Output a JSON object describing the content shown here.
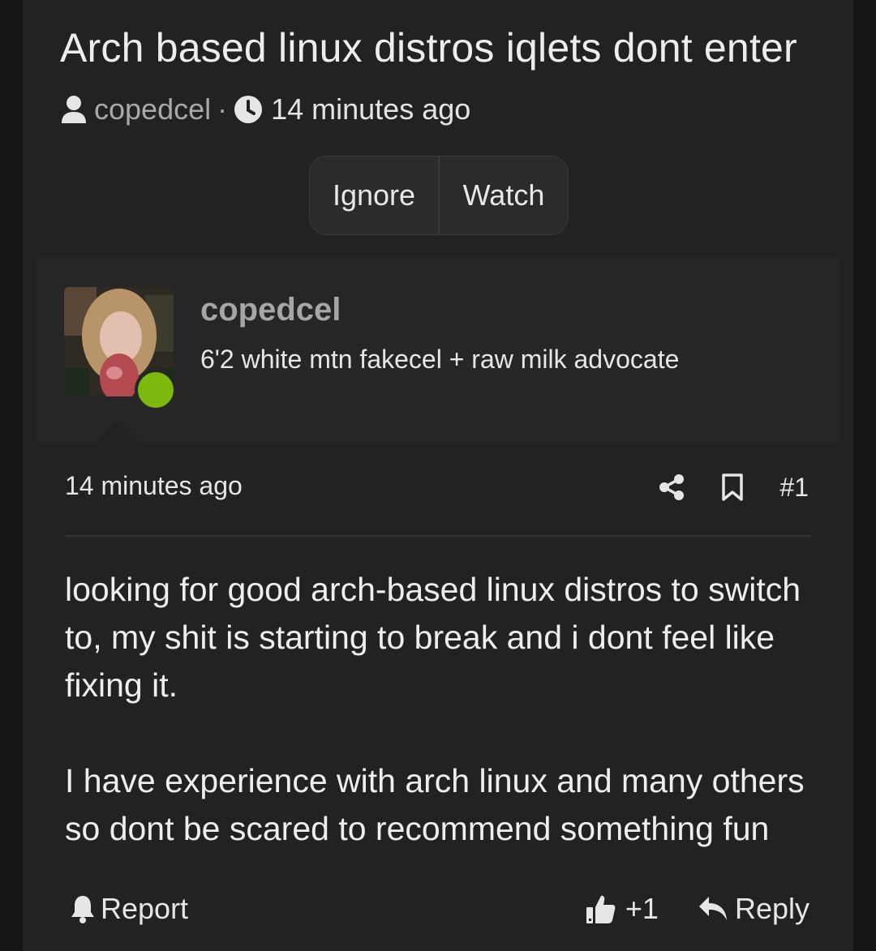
{
  "thread": {
    "title": "Arch based linux distros iqlets dont enter",
    "author": "copedcel",
    "separator": "·",
    "time": "14 minutes ago"
  },
  "thread_actions": {
    "ignore_label": "Ignore",
    "watch_label": "Watch"
  },
  "post": {
    "username": "copedcel",
    "user_title": "6'2 white mtn fakecel + raw milk advocate",
    "online": true,
    "date": "14 minutes ago",
    "post_number": "#1",
    "body": [
      "looking for good arch-based linux distros to switch to, my shit is starting to break and i dont feel like fixing it.",
      "I have experience with arch linux and many others so dont be scared to recommend something fun"
    ],
    "report_label": "Report",
    "reaction_count": "+1",
    "reply_label": "Reply"
  },
  "icons": {
    "author": "user-icon",
    "time": "clock-icon",
    "share": "share-icon",
    "bookmark": "bookmark-icon",
    "report": "bell-icon",
    "like": "thumbs-up-icon",
    "reply": "reply-icon"
  },
  "colors": {
    "background": "#222222",
    "user_block": "#262626",
    "online": "#7fb80f",
    "muted_text": "#a9a9a9"
  }
}
